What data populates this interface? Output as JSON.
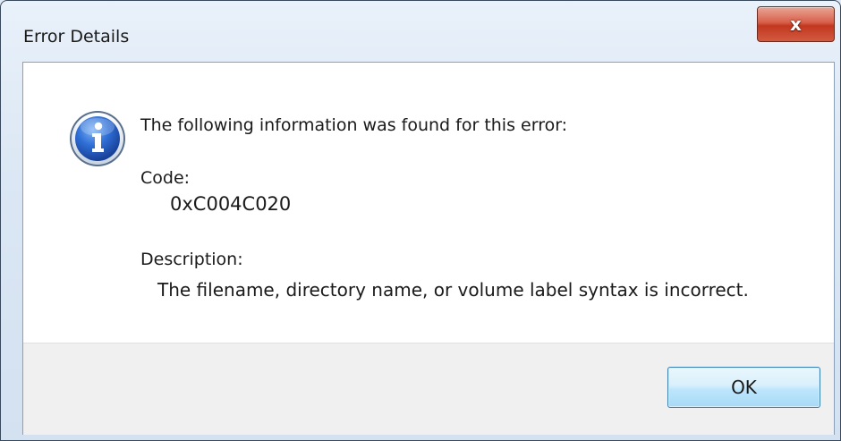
{
  "window": {
    "title": "Error Details",
    "close_icon_glyph": "x",
    "close_icon_name": "close-icon"
  },
  "message": {
    "icon": "information-icon",
    "heading": "The following information was found for this error:",
    "code_label": "Code:",
    "code_value": "0xC004C020",
    "description_label": "Description:",
    "description_value": "The filename, directory name, or volume label syntax is incorrect."
  },
  "buttons": {
    "ok_label": "OK"
  },
  "colors": {
    "close_button_red": "#c2381f",
    "info_icon_blue": "#2b5fbd",
    "ok_button_border": "#3c7fb1",
    "footer_background": "#f0f0f0"
  }
}
